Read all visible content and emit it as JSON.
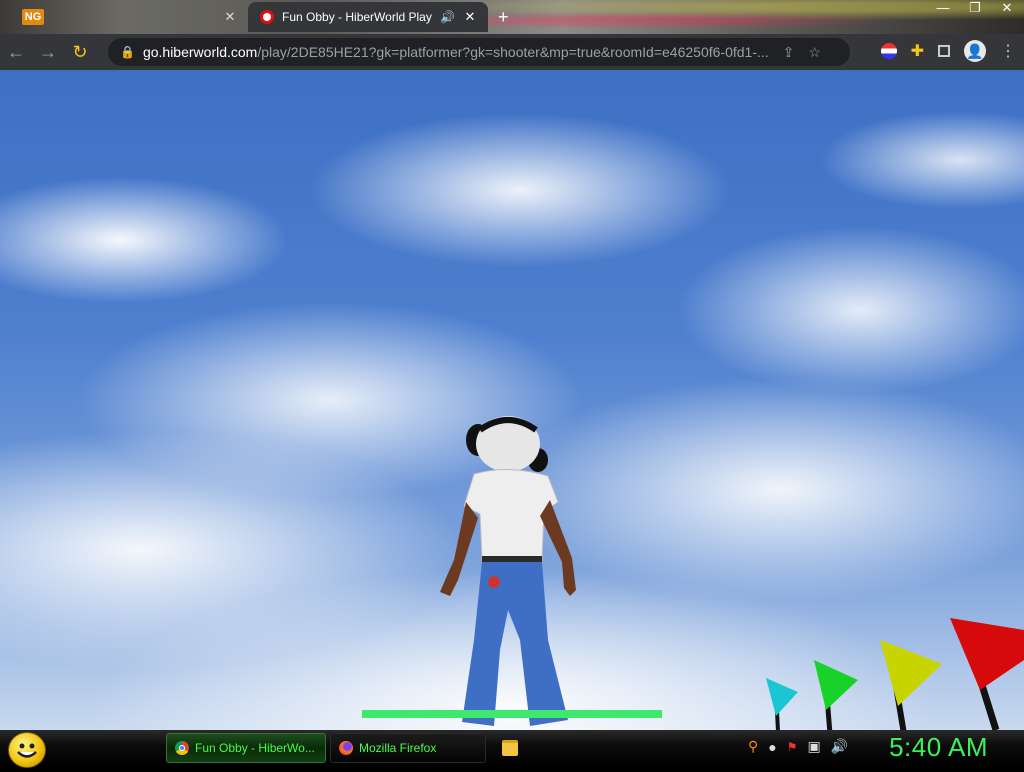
{
  "browser": {
    "tabs": [
      {
        "title": "",
        "active": false
      },
      {
        "title": "Fun Obby - HiberWorld Play",
        "active": true
      }
    ],
    "new_tab_symbol": "+",
    "window_controls": {
      "minimize": "—",
      "restore": "❐",
      "close": "✕"
    },
    "url_host": "go.hiberworld.com",
    "url_rest": "/play/2DE85HE21?gk=platformer?gk=shooter&mp=true&roomId=e46250f6-0fd1-...",
    "icons": {
      "back": "arrow-left-icon",
      "forward": "arrow-right-icon",
      "reload": "reload-icon",
      "lock": "lock-icon",
      "share": "share-icon",
      "bookmark": "star-icon",
      "extension": "puzzle-icon",
      "profile": "person-icon",
      "menu": "kebab-icon"
    }
  },
  "game": {
    "health_fraction": 1.0,
    "health_color": "#3ee86c",
    "flag_colors": [
      "#1bc6d4",
      "#18d22a",
      "#c8d400",
      "#d60a0a"
    ]
  },
  "taskbar": {
    "items": [
      {
        "label": "Fun Obby - HiberWo...",
        "active": true
      },
      {
        "label": "Mozilla Firefox",
        "active": false
      }
    ],
    "clock": "5:40 AM",
    "accent_color": "#3df05a"
  }
}
